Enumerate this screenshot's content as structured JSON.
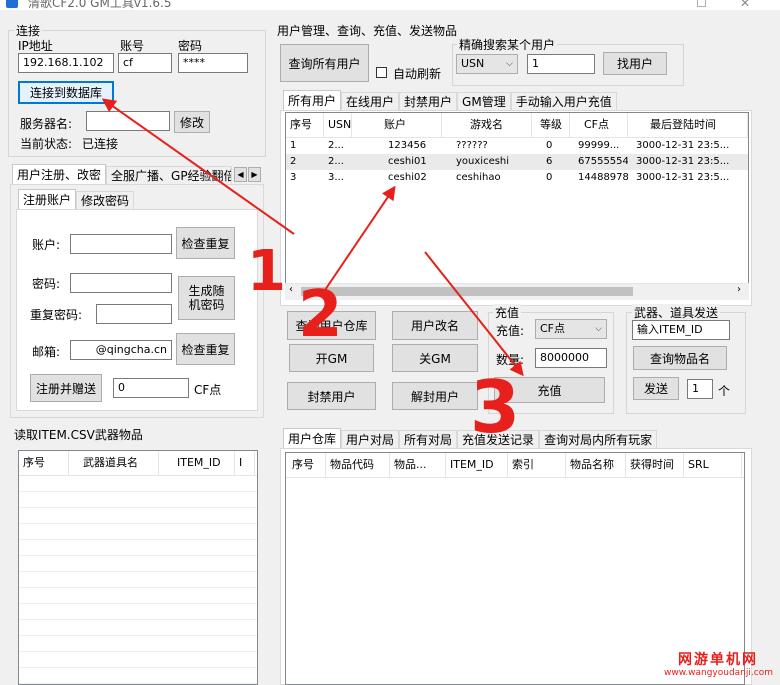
{
  "window": {
    "title": "清歌CF2.0 GM工具v1.6.5"
  },
  "connect": {
    "group_title": "连接",
    "ip_label": "IP地址",
    "ip_value": "192.168.1.102",
    "account_label": "账号",
    "account_value": "cf",
    "password_label": "密码",
    "password_value": "****",
    "connect_btn": "连接到数据库",
    "server_name_label": "服务器名:",
    "server_name_value": "",
    "modify_btn": "修改",
    "status_label": "当前状态:",
    "status_value": "已连接"
  },
  "register": {
    "outer_tabs": [
      "用户注册、改密",
      "全服广播、GP经验翻倍"
    ],
    "inner_tabs": [
      "注册账户",
      "修改密码"
    ],
    "account_label": "账户:",
    "account_value": "",
    "check_btn1": "检查重复",
    "password_label": "密码:",
    "password_value": "",
    "gen_btn_line1": "生成随",
    "gen_btn_line2": "机密码",
    "repeat_label": "重复密码:",
    "repeat_value": "",
    "email_label": "邮箱:",
    "email_value": "@qingcha.cn",
    "check_btn2": "检查重复",
    "register_btn": "注册并赠送",
    "gift_value": "0",
    "cf_unit": "CF点"
  },
  "items_csv": {
    "title": "读取ITEM.CSV武器物品",
    "columns": [
      "序号",
      "武器道具名",
      "ITEM_ID",
      "I"
    ]
  },
  "user_mgmt": {
    "title": "用户管理、查询、充值、发送物品",
    "query_all_btn": "查询所有用户",
    "auto_refresh_label": "自动刷新",
    "search_title": "精确搜索某个用户",
    "search_field": "USN",
    "search_value": "1",
    "find_btn": "找用户",
    "tabs": [
      "所有用户",
      "在线用户",
      "封禁用户",
      "GM管理",
      "手动输入用户充值"
    ],
    "columns": [
      "序号",
      "USN",
      "账户",
      "游戏名",
      "等级",
      "CF点",
      "最后登陆时间"
    ],
    "rows": [
      [
        "1",
        "2...",
        "123456",
        "??????",
        "0",
        "99999...",
        "3000-12-31 23:5..."
      ],
      [
        "2",
        "2...",
        "ceshi01",
        "youxiceshi",
        "6",
        "67555554",
        "3000-12-31 23:5..."
      ],
      [
        "3",
        "3...",
        "ceshi02",
        "ceshihao",
        "0",
        "14488978",
        "3000-12-31 23:5..."
      ]
    ]
  },
  "actions": {
    "warehouse_btn": "查询用户仓库",
    "rename_btn": "用户改名",
    "gm_on_btn": "开GM",
    "gm_off_btn": "关GM",
    "ban_btn": "封禁用户",
    "unban_btn": "解封用户"
  },
  "recharge": {
    "title": "充值",
    "type_label": "充值:",
    "type_value": "CF点",
    "amount_label": "数量:",
    "amount_value": "8000000",
    "recharge_btn": "充值"
  },
  "send_item": {
    "title": "武器、道具发送",
    "item_input": "输入ITEM_ID",
    "query_btn": "查询物品名",
    "send_btn": "发送",
    "count_value": "1",
    "count_unit": "个"
  },
  "warehouse": {
    "tabs": [
      "用户仓库",
      "用户对局",
      "所有对局",
      "充值发送记录",
      "查询对局内所有玩家"
    ],
    "columns": [
      "序号",
      "物品代码",
      "物品...",
      "ITEM_ID",
      "索引",
      "物品名称",
      "获得时间",
      "SRL"
    ]
  },
  "annotations": {
    "num1": "1",
    "num2": "2",
    "num3": "3",
    "color": "#e8201c"
  },
  "watermark": {
    "line1": "网游单机网",
    "line2": "www.wangyoudanji.com"
  }
}
